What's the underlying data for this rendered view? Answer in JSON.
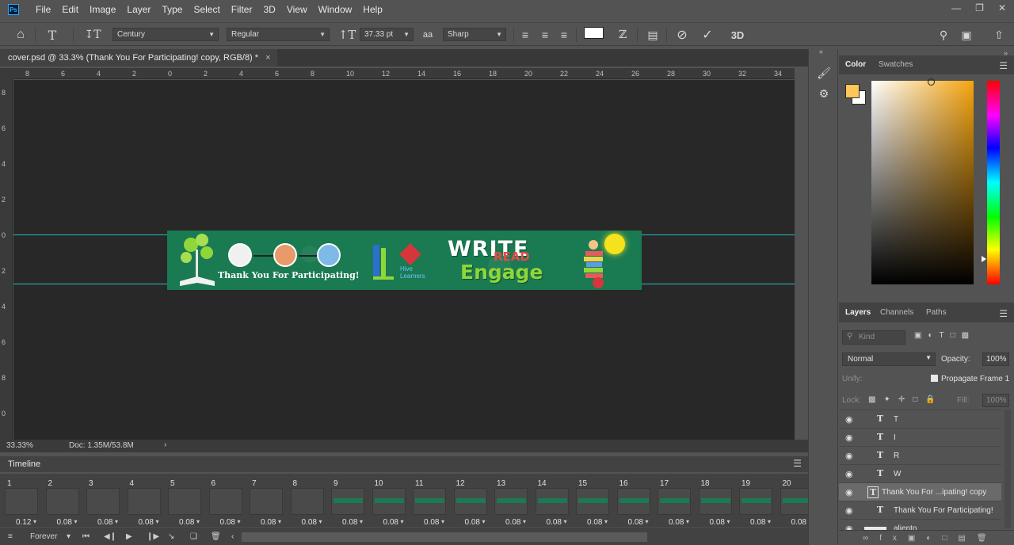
{
  "app": {
    "logo": "Ps"
  },
  "menu": [
    "File",
    "Edit",
    "Image",
    "Layer",
    "Type",
    "Select",
    "Filter",
    "3D",
    "View",
    "Window",
    "Help"
  ],
  "window_controls": [
    "minimize",
    "restore",
    "close"
  ],
  "options_bar": {
    "font_family": "Century",
    "font_style": "Regular",
    "font_size": "37.33 pt",
    "antialias_icon": "aa",
    "antialias": "Sharp",
    "text_color": "#ffffff",
    "icons": [
      "home-icon",
      "type-tool-icon",
      "orientation-icon",
      "size-icon",
      "align-left-icon",
      "align-center-icon",
      "align-right-icon",
      "warp-text-icon",
      "character-panel-icon",
      "cancel-icon",
      "commit-icon",
      "3d-icon",
      "search-icon",
      "workspace-icon",
      "share-icon"
    ]
  },
  "document": {
    "tab_title": "cover.psd @ 33.3% (Thank You For Participating! copy, RGB/8) *",
    "tab_close": "×"
  },
  "ruler": {
    "h_labels": [
      "8",
      "6",
      "4",
      "2",
      "0",
      "2",
      "4",
      "6",
      "8",
      "10",
      "12",
      "14",
      "16",
      "18",
      "20",
      "22",
      "24",
      "26",
      "28",
      "30",
      "32",
      "34"
    ],
    "v_labels": [
      "8",
      "6",
      "4",
      "2",
      "0",
      "2",
      "4",
      "6",
      "8",
      "0"
    ]
  },
  "banner": {
    "thank_you": "Thank You For Participating!",
    "hive_line1": "Hive",
    "hive_line2": "Learners",
    "write": "WRITE",
    "read": "READ",
    "engage": "Engage",
    "bg_color": "#1a7a52"
  },
  "status": {
    "zoom": "33.33%",
    "doc": "Doc: 1.35M/53.8M",
    "arrow": "›"
  },
  "timeline": {
    "title": "Timeline",
    "frames": [
      {
        "num": "1",
        "delay": "0.12"
      },
      {
        "num": "2",
        "delay": "0.08"
      },
      {
        "num": "3",
        "delay": "0.08"
      },
      {
        "num": "4",
        "delay": "0.08"
      },
      {
        "num": "5",
        "delay": "0.08"
      },
      {
        "num": "6",
        "delay": "0.08"
      },
      {
        "num": "7",
        "delay": "0.08"
      },
      {
        "num": "8",
        "delay": "0.08"
      },
      {
        "num": "9",
        "delay": "0.08"
      },
      {
        "num": "10",
        "delay": "0.08"
      },
      {
        "num": "11",
        "delay": "0.08"
      },
      {
        "num": "12",
        "delay": "0.08"
      },
      {
        "num": "13",
        "delay": "0.08"
      },
      {
        "num": "14",
        "delay": "0.08"
      },
      {
        "num": "15",
        "delay": "0.08"
      },
      {
        "num": "16",
        "delay": "0.08"
      },
      {
        "num": "17",
        "delay": "0.08"
      },
      {
        "num": "18",
        "delay": "0.08"
      },
      {
        "num": "19",
        "delay": "0.08"
      },
      {
        "num": "20",
        "delay": "0.08"
      }
    ],
    "loop": "Forever"
  },
  "color_panel": {
    "tabs": [
      "Color",
      "Swatches"
    ],
    "foreground": "#fdc75a",
    "background": "#ffffff"
  },
  "layers_panel": {
    "tabs": [
      "Layers",
      "Channels",
      "Paths"
    ],
    "kind_placeholder": "Kind",
    "blend_mode": "Normal",
    "opacity_label": "Opacity:",
    "opacity": "100%",
    "unify_label": "Unify:",
    "propagate": "Propagate Frame 1",
    "lock_label": "Lock:",
    "fill_label": "Fill:",
    "fill": "100%",
    "layers": [
      {
        "name": "T",
        "type": "text"
      },
      {
        "name": "I",
        "type": "text"
      },
      {
        "name": "R",
        "type": "text"
      },
      {
        "name": "W",
        "type": "text"
      },
      {
        "name": "Thank You For ...ipating! copy",
        "type": "text",
        "selected": true
      },
      {
        "name": "Thank You For Participating!",
        "type": "text"
      },
      {
        "name": "aliento",
        "type": "image"
      }
    ]
  }
}
